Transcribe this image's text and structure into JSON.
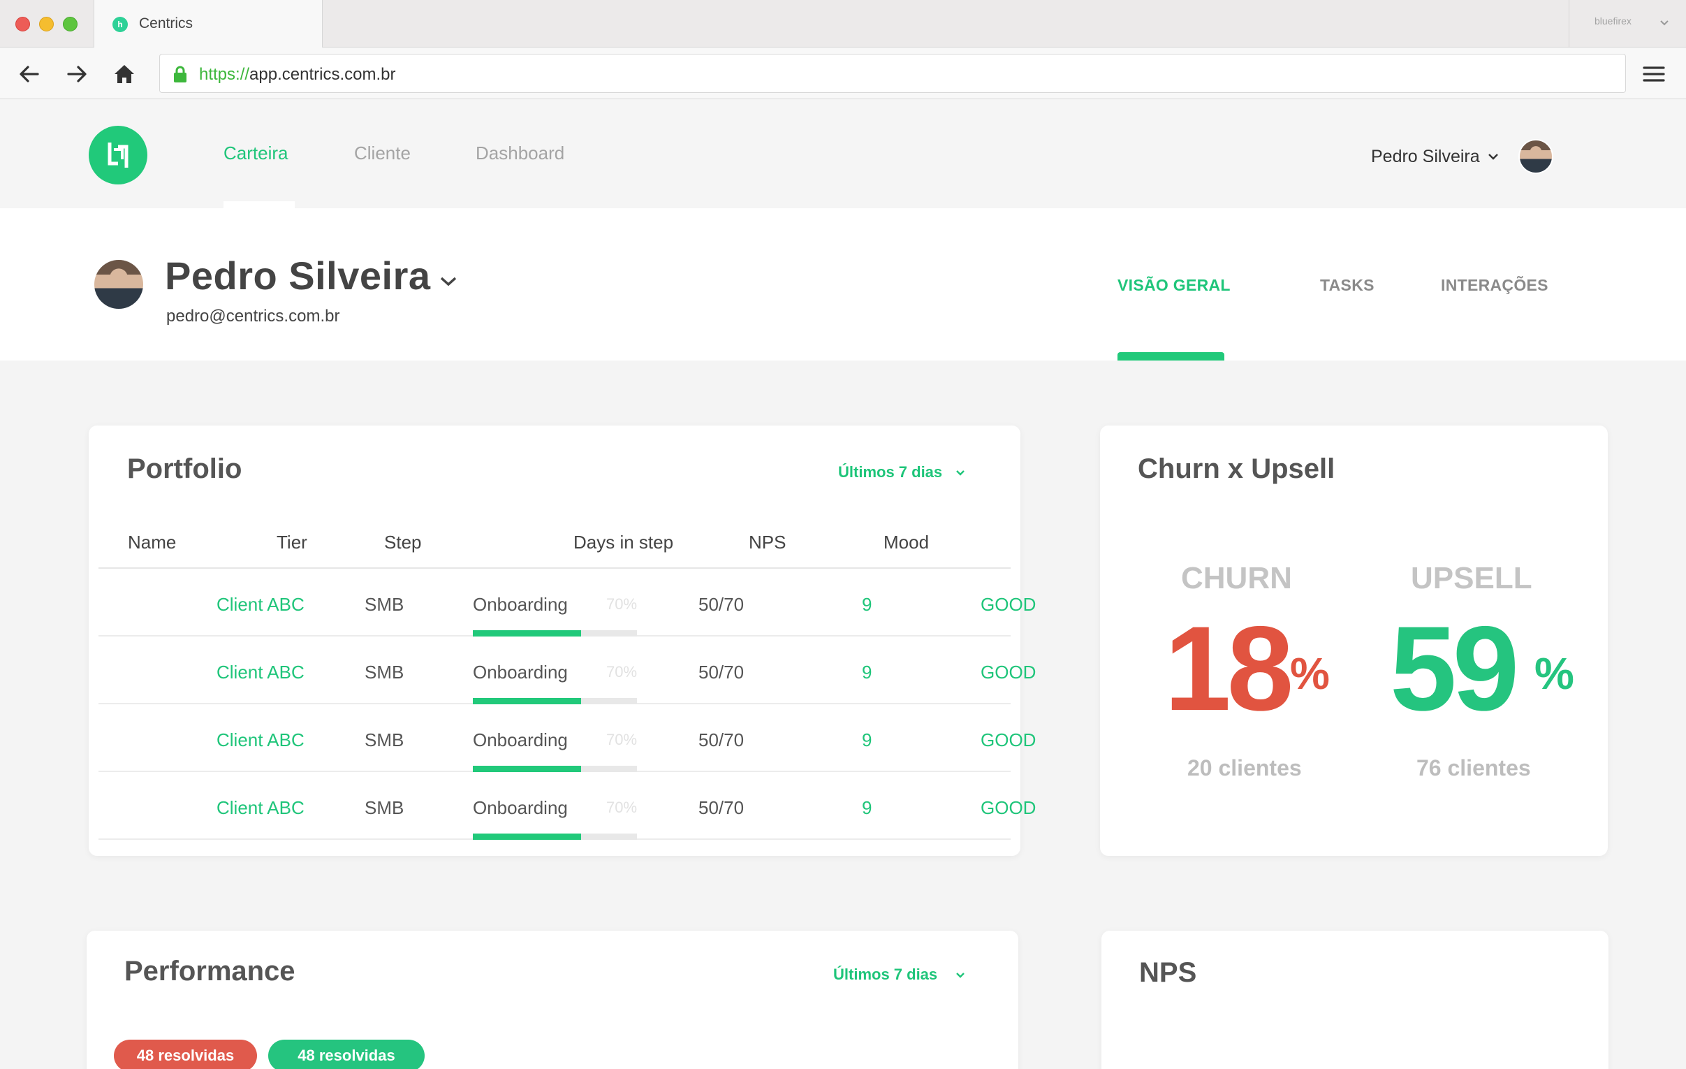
{
  "browser": {
    "tab_title": "Centrics",
    "favicon": "h",
    "profile": "bluefirex",
    "url_protocol": "https://",
    "url_rest": "app.centrics.com.br"
  },
  "nav": {
    "items": [
      "Carteira",
      "Cliente",
      "Dashboard"
    ],
    "user_name": "Pedro Silveira"
  },
  "profile": {
    "name": "Pedro Silveira",
    "email": "pedro@centrics.com.br",
    "tabs": [
      "VISÃO GERAL",
      "TASKS",
      "INTERAÇÕES"
    ]
  },
  "portfolio": {
    "title": "Portfolio",
    "range": "Últimos 7 dias",
    "columns": [
      "Name",
      "Tier",
      "Step",
      "Days in step",
      "NPS",
      "Mood"
    ],
    "rows": [
      {
        "name": "Client ABC",
        "tier": "SMB",
        "step": "Onboarding",
        "pct": "70%",
        "progress": 0.66,
        "days": "50/70",
        "nps": "9",
        "mood": "GOOD"
      },
      {
        "name": "Client ABC",
        "tier": "SMB",
        "step": "Onboarding",
        "pct": "70%",
        "progress": 0.66,
        "days": "50/70",
        "nps": "9",
        "mood": "GOOD"
      },
      {
        "name": "Client ABC",
        "tier": "SMB",
        "step": "Onboarding",
        "pct": "70%",
        "progress": 0.66,
        "days": "50/70",
        "nps": "9",
        "mood": "GOOD"
      },
      {
        "name": "Client ABC",
        "tier": "SMB",
        "step": "Onboarding",
        "pct": "70%",
        "progress": 0.66,
        "days": "50/70",
        "nps": "9",
        "mood": "GOOD"
      }
    ]
  },
  "churn_upsell": {
    "title": "Churn x Upsell",
    "churn": {
      "label": "CHURN",
      "value": "18",
      "unit": "%",
      "clients": "20 clientes",
      "color": "#e15440"
    },
    "upsell": {
      "label": "UPSELL",
      "value": "59",
      "unit": "%",
      "clients": "76 clientes",
      "color": "#25c47f"
    }
  },
  "performance": {
    "title": "Performance",
    "range": "Últimos 7 dias",
    "badges": [
      "48 resolvidas",
      "48 resolvidas"
    ]
  },
  "nps": {
    "title": "NPS"
  },
  "colors": {
    "brand": "#21c97a",
    "negative": "#e15440"
  }
}
